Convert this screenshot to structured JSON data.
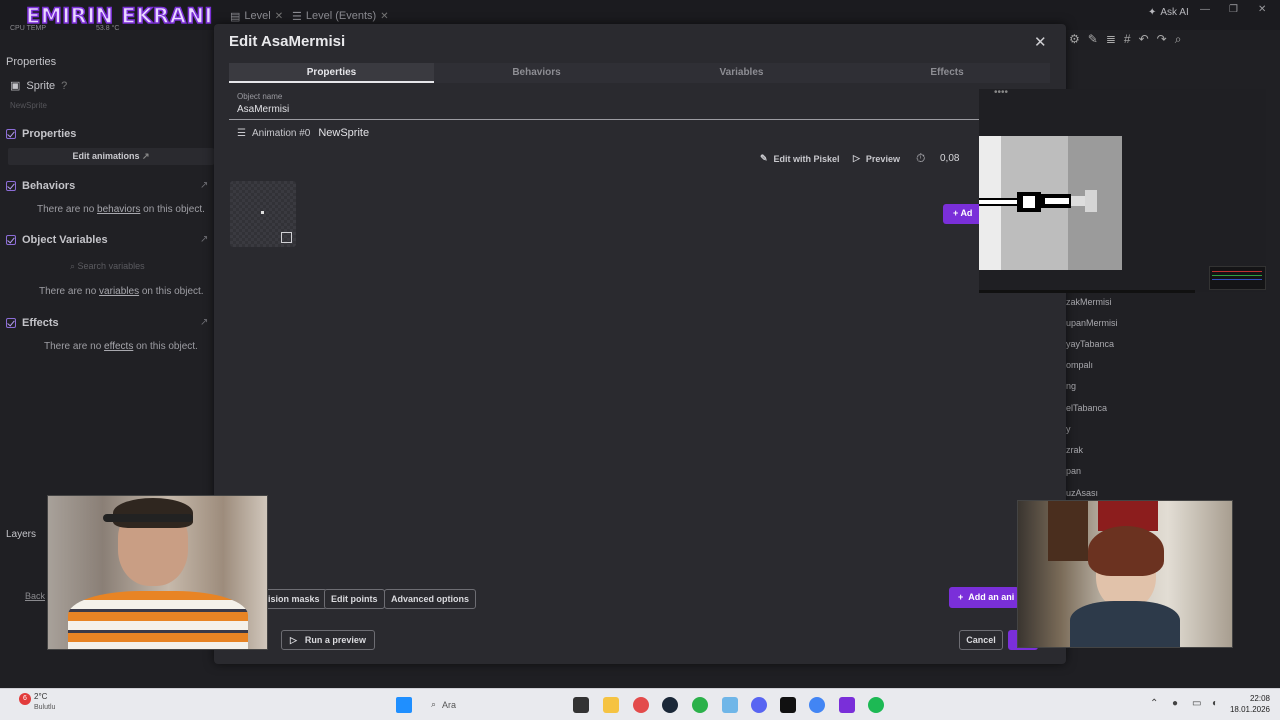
{
  "overlay": {
    "stream_title": "EMIRIN EKRANI",
    "cpu_label": "CPU TEMP",
    "cpu_temp": "53.8 °C"
  },
  "topbar": {
    "tabs": [
      {
        "label": "Level"
      },
      {
        "label": "Level (Events)"
      }
    ],
    "ask_ai": "Ask AI"
  },
  "left_panel": {
    "title": "Properties",
    "sprite_label": "Sprite",
    "subtitle": "NewSprite",
    "properties_label": "Properties",
    "edit_animations": "Edit animations",
    "behaviors_label": "Behaviors",
    "behaviors_empty": [
      "There are no ",
      "behaviors",
      " on this object."
    ],
    "variables_label": "Object Variables",
    "search_placeholder": "Search variables",
    "variables_empty": [
      "There are no ",
      "variables",
      " on this object."
    ],
    "effects_label": "Effects",
    "effects_empty": [
      "There are no ",
      "effects",
      " on this object."
    ],
    "layers_label": "Layers",
    "layers_item": "Back"
  },
  "right_panel": {
    "items": [
      "zakMermisi",
      "upanMermisi",
      "yayTabanca",
      "ompalı",
      "ng",
      "elTabanca",
      "y",
      "zrak",
      "pan",
      "uzAsası"
    ]
  },
  "dialog": {
    "title": "Edit AsaMermisi",
    "tabs": [
      {
        "label": "Properties",
        "active": true
      },
      {
        "label": "Behaviors",
        "active": false
      },
      {
        "label": "Variables",
        "active": false
      },
      {
        "label": "Effects",
        "active": false
      }
    ],
    "object_name_label": "Object name",
    "object_name_value": "AsaMermisi",
    "animation_label": "Animation #0",
    "animation_name": "NewSprite",
    "edit_with_piskel": "Edit with Piskel",
    "preview": "Preview",
    "frame_duration": "0,08",
    "add_frame": "Ad",
    "bottom_buttons": {
      "collision_masks": "ision masks",
      "edit_points": "Edit points",
      "advanced_options": "Advanced options",
      "add_animation": "Add an ani",
      "run_preview": "Run a preview",
      "cancel": "Cancel"
    }
  },
  "taskbar": {
    "weather_temp": "2°C",
    "weather_desc": "Bulutlu",
    "search_placeholder": "Ara",
    "time": "22:08",
    "date": "18.01.2026",
    "notif_badge": "6"
  },
  "colors": {
    "accent": "#7a2fd9",
    "dialog_bg": "#2a2a2f",
    "panel_bg": "#202024",
    "taskbar_bg": "#e9eaee"
  }
}
